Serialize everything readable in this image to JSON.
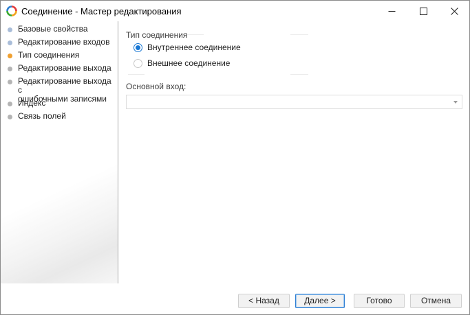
{
  "window": {
    "title": "Соединение - Мастер редактирования",
    "app_icon": "app-logo-icon",
    "controls": [
      "minimize-icon",
      "maximize-icon",
      "close-icon"
    ]
  },
  "sidebar": {
    "items": [
      {
        "label": "Базовые свойства",
        "state": "done"
      },
      {
        "label": "Редактирование входов",
        "state": "done"
      },
      {
        "label": "Тип соединения",
        "state": "current"
      },
      {
        "label": "Редактирование выхода",
        "state": "pending"
      },
      {
        "label": "Редактирование выхода с\nошибочными записями",
        "state": "pending"
      },
      {
        "label": "Индекс",
        "state": "pending"
      },
      {
        "label": "Связь полей",
        "state": "pending"
      }
    ]
  },
  "main": {
    "join_type": {
      "title": "Тип соединения",
      "options": [
        {
          "label": "Внутреннее соединение",
          "checked": true
        },
        {
          "label": "Внешнее соединение",
          "checked": false
        }
      ]
    },
    "main_input": {
      "label": "Основной вход:",
      "value": ""
    }
  },
  "buttons": {
    "back": "< Назад",
    "next": "Далее >",
    "finish": "Готово",
    "cancel": "Отмена"
  },
  "colors": {
    "step_done": "#a9bdd9",
    "step_current": "#f0a030",
    "step_pending": "#b4b4b4",
    "accent": "#1a78d4"
  }
}
